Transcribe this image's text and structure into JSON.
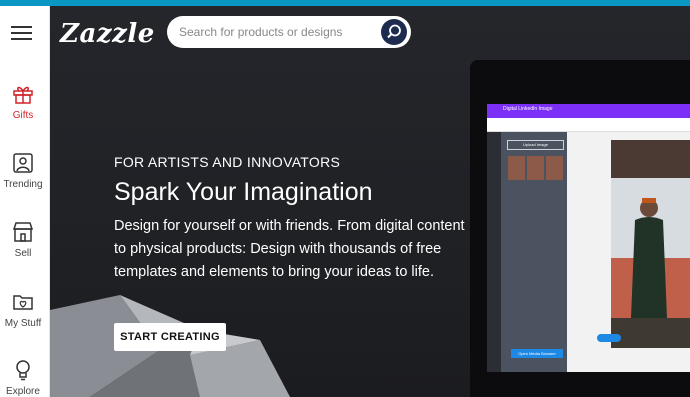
{
  "brand": {
    "name": "Zazzle"
  },
  "search": {
    "placeholder": "Search for products or designs",
    "icon": "search-icon"
  },
  "rail": {
    "items": [
      {
        "label": "Gifts",
        "icon": "gift-icon",
        "active": true
      },
      {
        "label": "Trending",
        "icon": "trending-icon"
      },
      {
        "label": "Sell",
        "icon": "storefront-icon"
      },
      {
        "label": "My Stuff",
        "icon": "folder-heart-icon"
      },
      {
        "label": "Explore",
        "icon": "lightbulb-icon"
      }
    ]
  },
  "hero": {
    "kicker": "FOR ARTISTS AND INNOVATORS",
    "headline": "Spark Your Imagination",
    "body": "Design for yourself or with friends. From digital content to physical products: Design with thousands of free templates and elements to bring your ideas to life.",
    "cta": "START CREATING"
  },
  "colors": {
    "accent_bar": "#0b97c4",
    "gift_red": "#d2232a",
    "search_button": "#1d2b4f",
    "editor_purple": "#7b2ff7"
  }
}
